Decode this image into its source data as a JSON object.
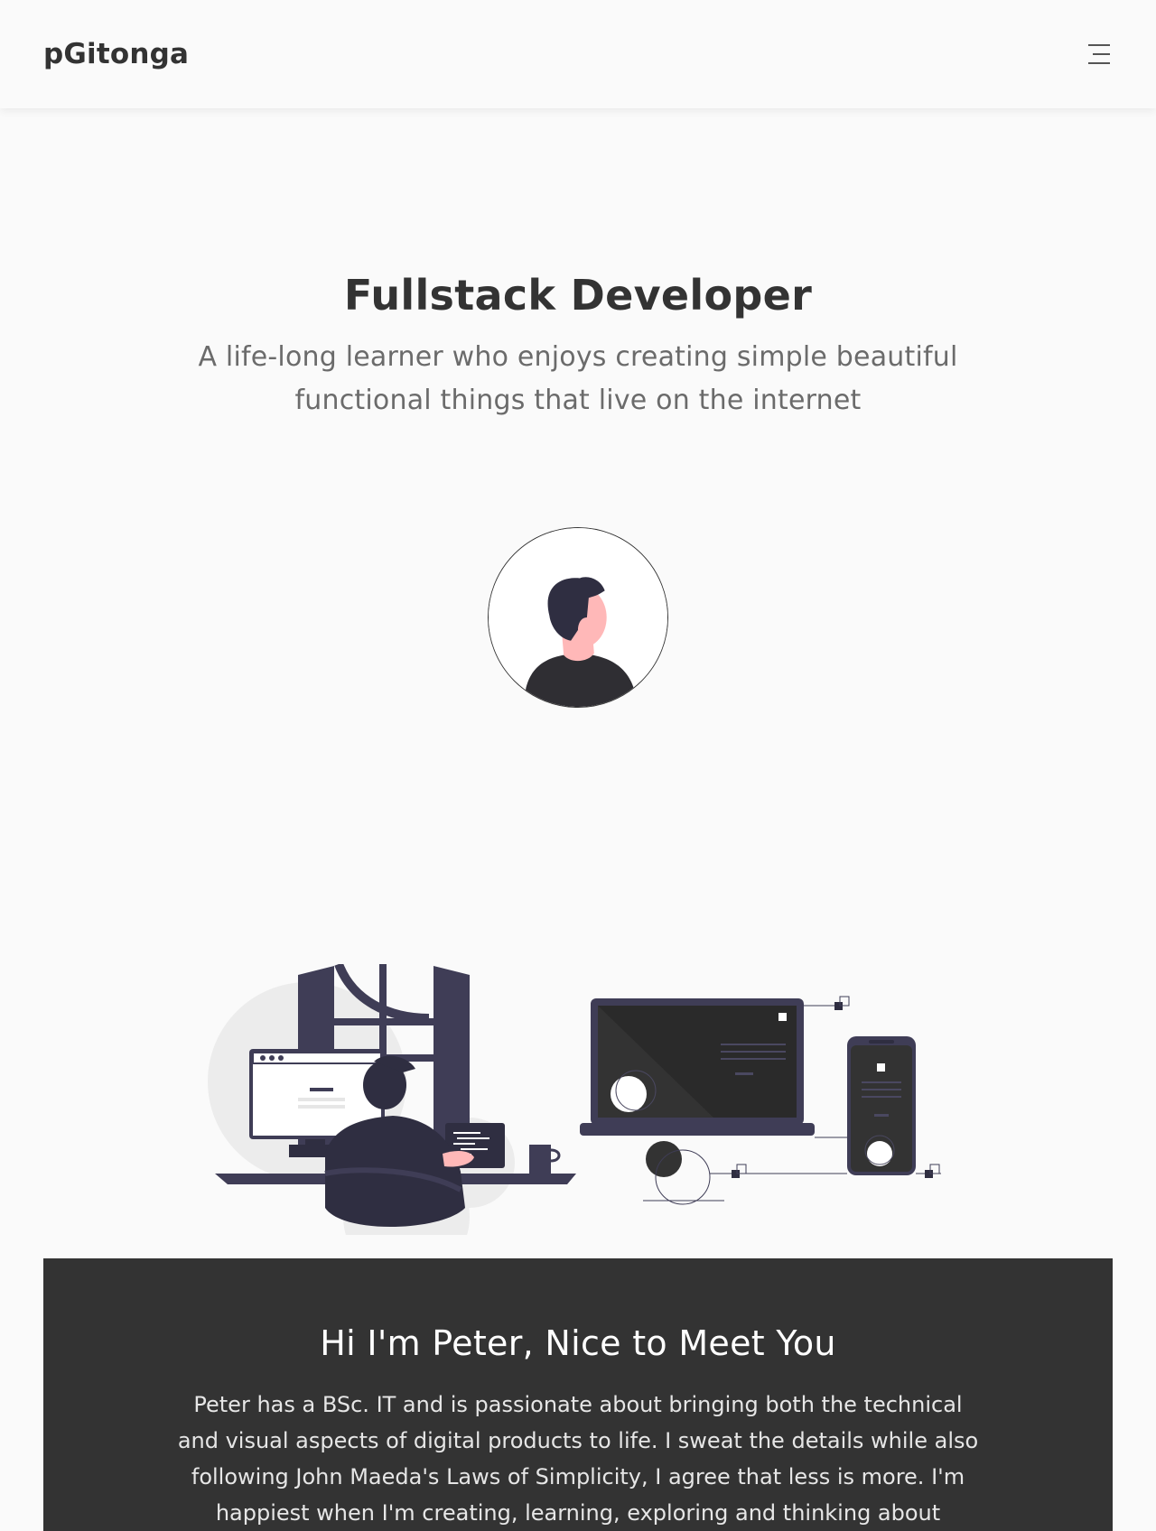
{
  "navbar": {
    "brand": "pGitonga",
    "menu_icon": "hamburger-menu-icon"
  },
  "hero": {
    "title": "Fullstack Developer",
    "subtitle": "A life-long learner who enjoys creating simple beautiful functional things that live on the internet"
  },
  "avatar": {
    "icon": "user-avatar-illustration"
  },
  "illustration": {
    "icon": "developer-workspace-illustration"
  },
  "about": {
    "title": "Hi I'm Peter, Nice to Meet You",
    "text": "Peter has a BSc. IT and is passionate about bringing both the technical and visual aspects of digital products to life. I sweat the details while also following John Maeda's Laws of Simplicity, I agree that less is more. I'm happiest when I'm creating, learning, exploring and thinking about"
  },
  "colors": {
    "background": "#fafafa",
    "text": "#333333",
    "muted": "#6b6b6b",
    "dark_panel": "#333333",
    "illustration_purple": "#3f3d56",
    "skin": "#ffb8b8"
  }
}
